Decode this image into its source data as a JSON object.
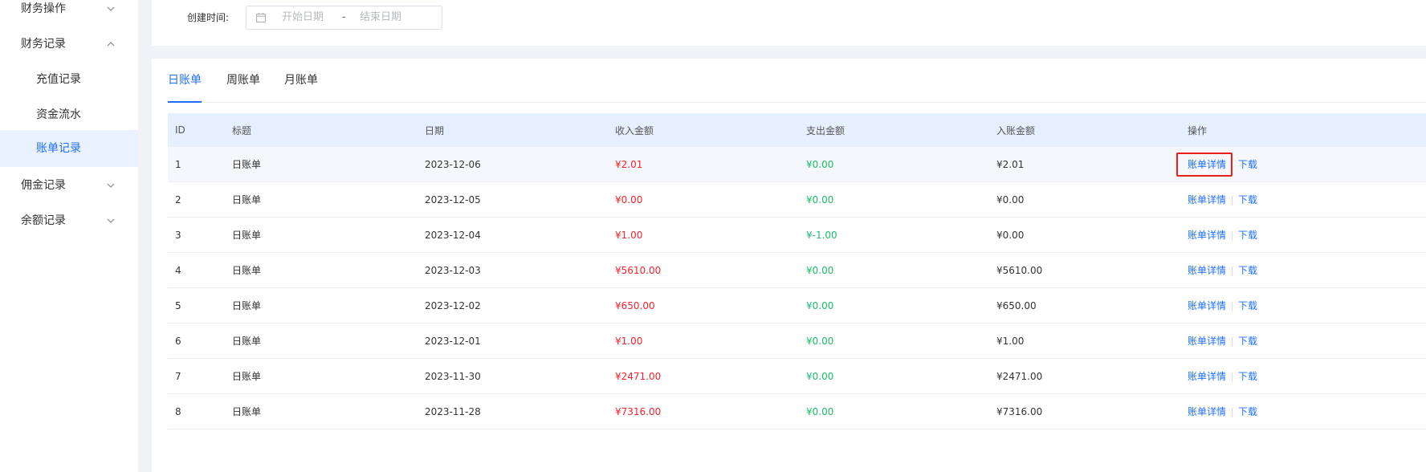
{
  "sidebar": {
    "items": [
      {
        "label": "财务操作",
        "expanded": false
      },
      {
        "label": "财务记录",
        "expanded": true
      },
      {
        "label": "充值记录"
      },
      {
        "label": "资金流水"
      },
      {
        "label": "账单记录",
        "active": true
      },
      {
        "label": "佣金记录",
        "expanded": false
      },
      {
        "label": "余额记录",
        "expanded": false
      }
    ]
  },
  "filter": {
    "label": "创建时间:",
    "start_placeholder": "开始日期",
    "separator": "-",
    "end_placeholder": "结束日期"
  },
  "tabs": [
    {
      "label": "日账单",
      "active": true
    },
    {
      "label": "周账单"
    },
    {
      "label": "月账单"
    }
  ],
  "table": {
    "columns": [
      "ID",
      "标题",
      "日期",
      "收入金额",
      "支出金额",
      "入账金额",
      "操作"
    ],
    "action_detail": "账单详情",
    "action_download": "下载",
    "rows": [
      [
        "1",
        "日账单",
        "2023-12-06",
        "¥2.01",
        "¥0.00",
        "¥2.01"
      ],
      [
        "2",
        "日账单",
        "2023-12-05",
        "¥0.00",
        "¥0.00",
        "¥0.00"
      ],
      [
        "3",
        "日账单",
        "2023-12-04",
        "¥1.00",
        "¥-1.00",
        "¥0.00"
      ],
      [
        "4",
        "日账单",
        "2023-12-03",
        "¥5610.00",
        "¥0.00",
        "¥5610.00"
      ],
      [
        "5",
        "日账单",
        "2023-12-02",
        "¥650.00",
        "¥0.00",
        "¥650.00"
      ],
      [
        "6",
        "日账单",
        "2023-12-01",
        "¥1.00",
        "¥0.00",
        "¥1.00"
      ],
      [
        "7",
        "日账单",
        "2023-11-30",
        "¥2471.00",
        "¥0.00",
        "¥2471.00"
      ],
      [
        "8",
        "日账单",
        "2023-11-28",
        "¥7316.00",
        "¥0.00",
        "¥7316.00"
      ]
    ]
  },
  "colors": {
    "accent": "#1e6fff",
    "income": "#f5222d",
    "expense": "#19be6b",
    "highlight_box": "#e8201c"
  }
}
